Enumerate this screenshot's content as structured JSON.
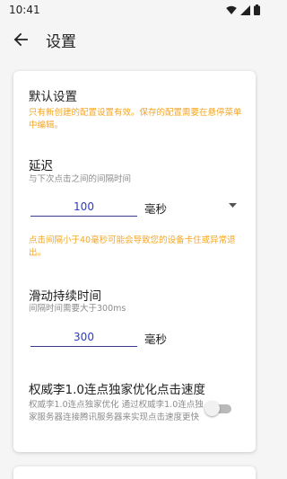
{
  "status_bar": {
    "time": "10:41",
    "icons": [
      "wifi-icon",
      "signal-icon",
      "battery-icon"
    ]
  },
  "app_bar": {
    "back_icon": "arrow-left-icon",
    "title": "设置"
  },
  "default_settings": {
    "title": "默认设置",
    "note": "只有新创建的配置设置有效。保存的配置需要在悬停菜单中编辑。"
  },
  "delay": {
    "title": "延迟",
    "hint": "与下次点击之间的间隔时间",
    "value": "100",
    "unit": "毫秒",
    "warning": "点击间隔小于40毫秒可能会导致您的设备卡住或异常退出。"
  },
  "swipe_duration": {
    "title": "滑动持续时间",
    "hint": "间隔时间需要大于300ms",
    "value": "300",
    "unit": "毫秒"
  },
  "optimize": {
    "title": "权威李1.0连点独家优化点击速度",
    "hint": "权威李1.0连点独家优化  通过权威李1.0连点独家服务器连接腾讯服务器来实现点击速度更快",
    "enabled": false
  },
  "colors": {
    "warning": "#f5a623",
    "input_text": "#2a3bc8",
    "switch_off_track": "#b9b9b9"
  }
}
